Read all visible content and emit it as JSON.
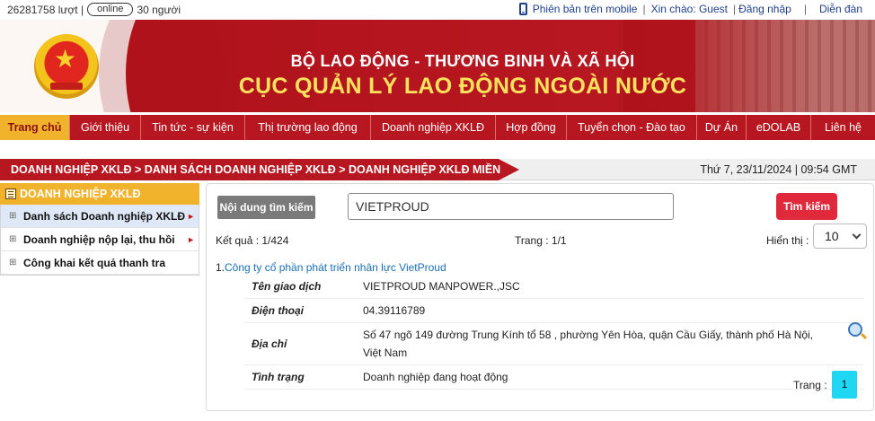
{
  "topbar": {
    "visits": "26281758 lượt |",
    "online": "online",
    "people": "30 người",
    "mobile": "Phiên bản trên mobile",
    "greeting": "Xin chào: Guest",
    "login": "Đăng nhập",
    "forum": "Diễn đàn",
    "sep": "|"
  },
  "header": {
    "ministry": "BỘ LAO ĐỘNG - THƯƠNG BINH VÀ XÃ HỘI",
    "department": "CỤC QUẢN LÝ LAO ĐỘNG NGOÀI NƯỚC"
  },
  "nav": {
    "items": [
      {
        "label": "Trang chủ"
      },
      {
        "label": "Giới thiệu"
      },
      {
        "label": "Tin tức - sự kiện"
      },
      {
        "label": "Thị trường lao động"
      },
      {
        "label": "Doanh nghiệp XKLĐ"
      },
      {
        "label": "Hợp đồng"
      },
      {
        "label": "Tuyển chọn - Đào tạo"
      },
      {
        "label": "Dự Án"
      },
      {
        "label": "eDOLAB"
      },
      {
        "label": "Liên hệ"
      }
    ]
  },
  "breadcrumb": "DOANH NGHIỆP XKLĐ > DANH SÁCH DOANH NGHIỆP XKLĐ > DOANH NGHIỆP XKLĐ MIỀN BẮC",
  "datetime": "Thứ 7, 23/11/2024 | 09:54 GMT",
  "sidebar": {
    "title": "DOANH NGHIỆP XKLĐ",
    "items": [
      {
        "label": "Danh sách Doanh nghiệp XKLĐ"
      },
      {
        "label": "Doanh nghiệp nộp lại, thu hồi"
      },
      {
        "label": "Công khai kết quả thanh tra"
      }
    ]
  },
  "search": {
    "label": "Nội dung tìm kiếm",
    "value": "VIETPROUD",
    "button": "Tìm kiếm"
  },
  "results": {
    "count": "Kết quả : 1/424",
    "page": "Trang : 1/1",
    "show_label": "Hiển thị :",
    "show_value": "10"
  },
  "company": {
    "index": "1.",
    "name": "Công ty cổ phần phát triển nhân lực VietProud",
    "rows": [
      {
        "key": "Tên giao dịch",
        "value": "VIETPROUD MANPOWER.,JSC"
      },
      {
        "key": "Điện thoại",
        "value": "04.39116789"
      },
      {
        "key": "Địa chỉ",
        "value": "Số 47 ngõ 149 đường Trung Kính tổ 58 , phường Yên Hòa, quận Cầu Giấy, thành phố Hà Nội, Việt Nam"
      },
      {
        "key": "Tình trạng",
        "value": "Doanh nghiệp đang hoạt động"
      }
    ]
  },
  "pager": {
    "label": "Trang :",
    "current": "1"
  }
}
